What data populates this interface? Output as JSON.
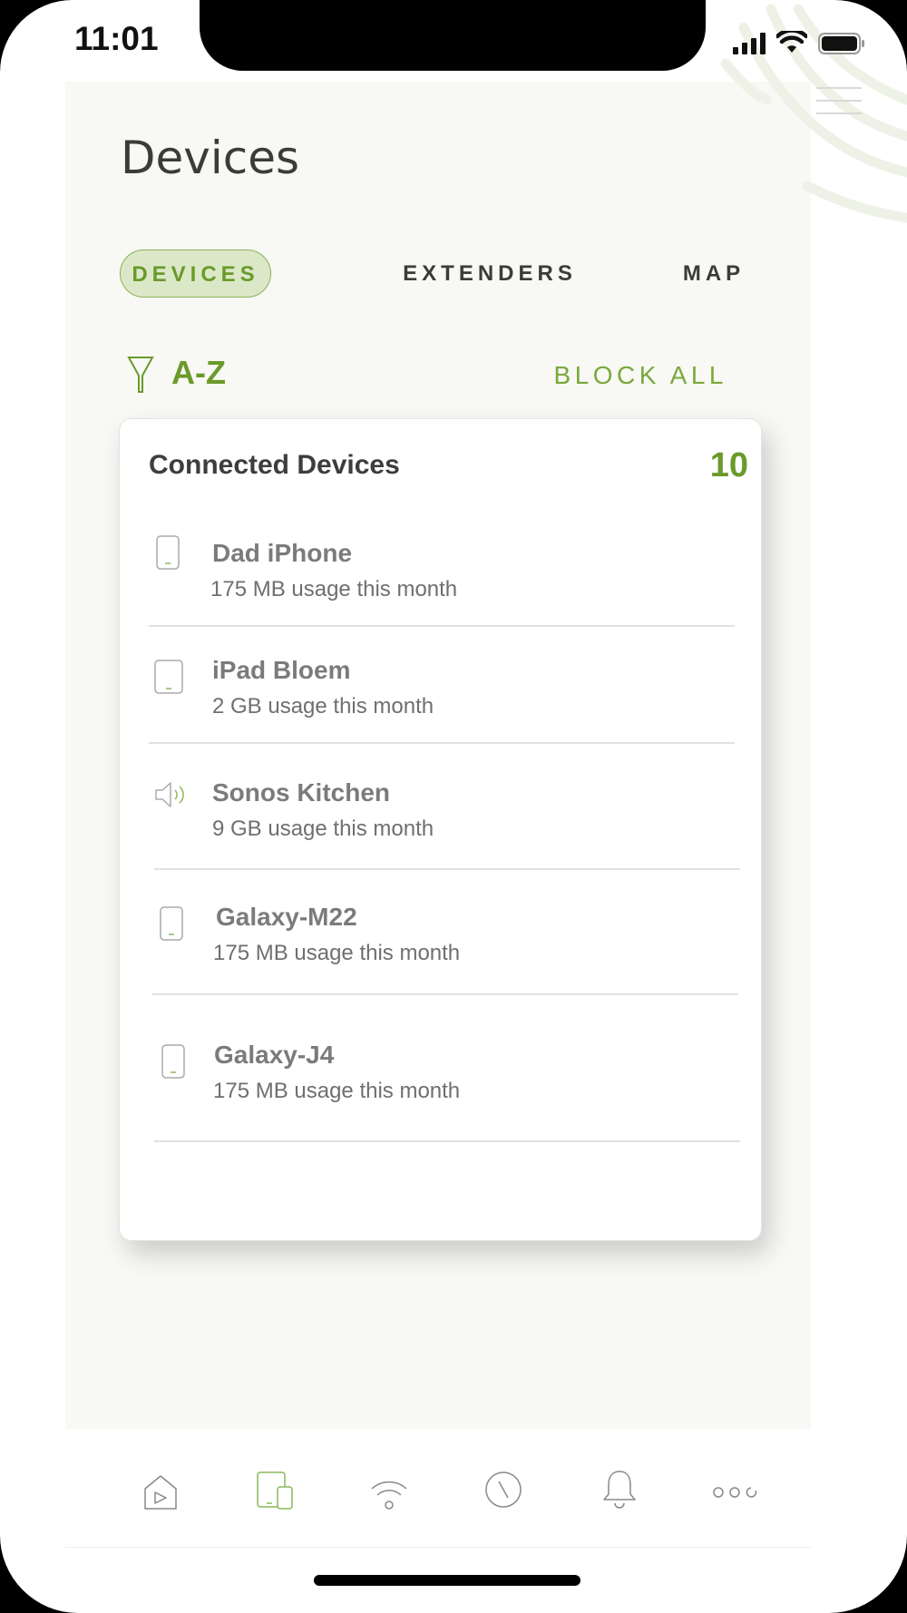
{
  "status_bar": {
    "time": "11:01"
  },
  "page": {
    "title": "Devices"
  },
  "tabs": [
    {
      "label": "DEVICES",
      "active": true
    },
    {
      "label": "EXTENDERS",
      "active": false
    },
    {
      "label": "MAP",
      "active": false
    }
  ],
  "filter": {
    "sort_label": "A-Z",
    "block_all_label": "BLOCK ALL"
  },
  "card": {
    "title": "Connected Devices",
    "count": "10",
    "devices": [
      {
        "name": "Dad iPhone",
        "usage": "175 MB usage this month",
        "icon": "phone-icon"
      },
      {
        "name": "iPad Bloem",
        "usage": "2 GB usage this month",
        "icon": "tablet-icon"
      },
      {
        "name": "Sonos Kitchen",
        "usage": "9 GB usage this month",
        "icon": "speaker-icon"
      },
      {
        "name": "Galaxy-M22",
        "usage": "175 MB usage this month",
        "icon": "phone-icon"
      },
      {
        "name": "Galaxy-J4",
        "usage": "175 MB usage this month",
        "icon": "phone-icon"
      }
    ]
  },
  "bottom_nav": [
    {
      "icon": "home-icon",
      "active": false
    },
    {
      "icon": "devices-icon",
      "active": true
    },
    {
      "icon": "wifi-icon",
      "active": false
    },
    {
      "icon": "clock-icon",
      "active": false
    },
    {
      "icon": "bell-icon",
      "active": false
    },
    {
      "icon": "more-icon",
      "active": false
    }
  ],
  "colors": {
    "accent": "#6a9a2a",
    "accent_light": "#dbe8c7",
    "text_dark": "#3b3b3b",
    "text_muted": "#7b7b7b"
  }
}
